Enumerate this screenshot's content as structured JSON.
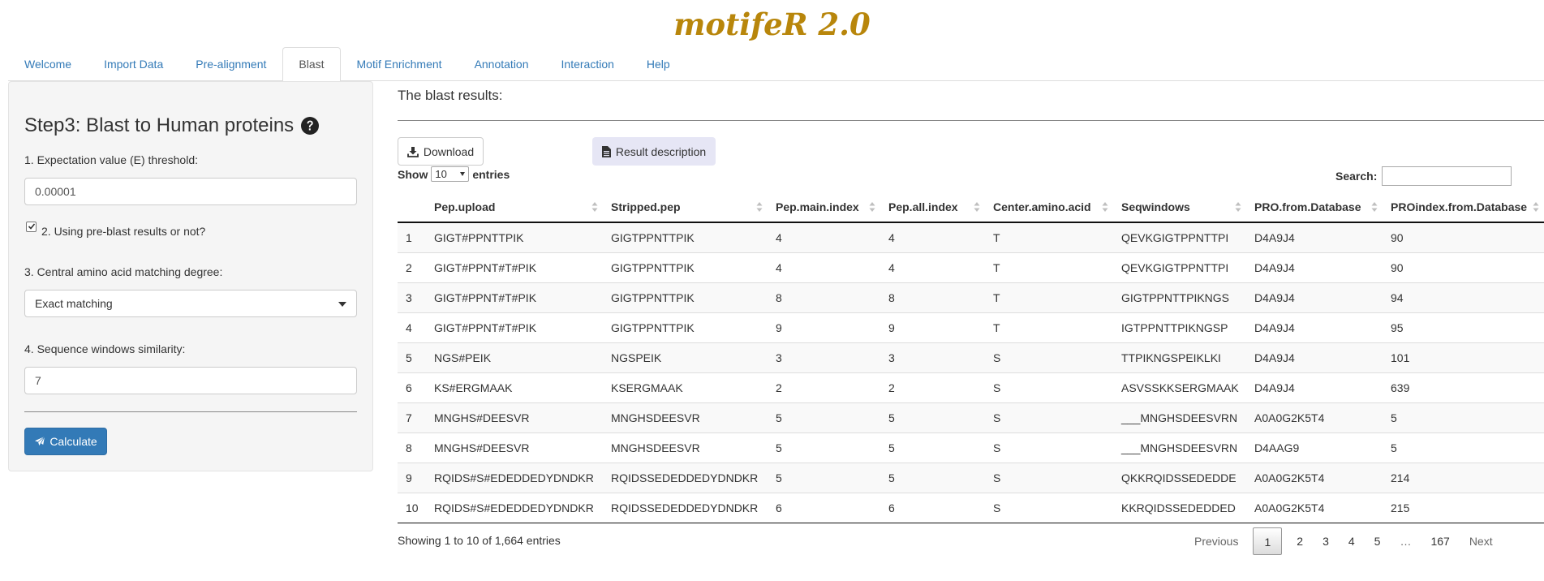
{
  "app": {
    "title": "motifeR 2.0"
  },
  "nav": {
    "tabs": [
      {
        "label": "Welcome"
      },
      {
        "label": "Import Data"
      },
      {
        "label": "Pre-alignment"
      },
      {
        "label": "Blast",
        "active": true
      },
      {
        "label": "Motif Enrichment"
      },
      {
        "label": "Annotation"
      },
      {
        "label": "Interaction"
      },
      {
        "label": "Help"
      }
    ]
  },
  "sidebar": {
    "title": "Step3: Blast to Human proteins",
    "evalue_label": "1. Expectation value (E) threshold:",
    "evalue_value": "0.00001",
    "preblast_label": "2. Using pre-blast results or not?",
    "preblast_checked": true,
    "central_label": "3. Central amino acid matching degree:",
    "central_value": "Exact matching",
    "similarity_label": "4. Sequence windows similarity:",
    "similarity_value": "7",
    "calculate_label": "Calculate"
  },
  "main": {
    "title": "The blast results:",
    "download_label": "Download",
    "description_label": "Result description",
    "show_label": "Show",
    "entries_label": "entries",
    "length_value": "10",
    "search_label": "Search:",
    "search_value": ""
  },
  "table": {
    "columns": [
      "",
      "Pep.upload",
      "Stripped.pep",
      "Pep.main.index",
      "Pep.all.index",
      "Center.amino.acid",
      "Seqwindows",
      "PRO.from.Database",
      "PROindex.from.Database"
    ],
    "rows": [
      [
        "1",
        "GIGT#PPNTTPIK",
        "GIGTPPNTTPIK",
        "4",
        "4",
        "T",
        "QEVKGIGTPPNTTPI",
        "D4A9J4",
        "90"
      ],
      [
        "2",
        "GIGT#PPNT#T#PIK",
        "GIGTPPNTTPIK",
        "4",
        "4",
        "T",
        "QEVKGIGTPPNTTPI",
        "D4A9J4",
        "90"
      ],
      [
        "3",
        "GIGT#PPNT#T#PIK",
        "GIGTPPNTTPIK",
        "8",
        "8",
        "T",
        "GIGTPPNTTPIKNGS",
        "D4A9J4",
        "94"
      ],
      [
        "4",
        "GIGT#PPNT#T#PIK",
        "GIGTPPNTTPIK",
        "9",
        "9",
        "T",
        "IGTPPNTTPIKNGSP",
        "D4A9J4",
        "95"
      ],
      [
        "5",
        "NGS#PEIK",
        "NGSPEIK",
        "3",
        "3",
        "S",
        "TTPIKNGSPEIKLKI",
        "D4A9J4",
        "101"
      ],
      [
        "6",
        "KS#ERGMAAK",
        "KSERGMAAK",
        "2",
        "2",
        "S",
        "ASVSSKKSERGMAAK",
        "D4A9J4",
        "639"
      ],
      [
        "7",
        "MNGHS#DEESVR",
        "MNGHSDEESVR",
        "5",
        "5",
        "S",
        "___MNGHSDEESVRN",
        "A0A0G2K5T4",
        "5"
      ],
      [
        "8",
        "MNGHS#DEESVR",
        "MNGHSDEESVR",
        "5",
        "5",
        "S",
        "___MNGHSDEESVRN",
        "D4AAG9",
        "5"
      ],
      [
        "9",
        "RQIDS#S#EDEDDEDYDNDKR",
        "RQIDSSEDEDDEDYDNDKR",
        "5",
        "5",
        "S",
        "QKKRQIDSSEDEDDE",
        "A0A0G2K5T4",
        "214"
      ],
      [
        "10",
        "RQIDS#S#EDEDDEDYDNDKR",
        "RQIDSSEDEDDEDYDNDKR",
        "6",
        "6",
        "S",
        "KKRQIDSSEDEDDED",
        "A0A0G2K5T4",
        "215"
      ]
    ],
    "info": "Showing 1 to 10 of 1,664 entries"
  },
  "pagination": {
    "previous": "Previous",
    "pages": [
      "1",
      "2",
      "3",
      "4",
      "5",
      "…",
      "167"
    ],
    "current": "1",
    "next": "Next"
  },
  "colors": {
    "title": "#b8860b",
    "link": "#337ab7",
    "primary_button": "#337ab7",
    "description_button": "#e6e6f5",
    "sidebar_bg": "#f5f5f5"
  },
  "icons": {
    "help": "question-circle-icon",
    "download": "download-icon",
    "description": "file-text-icon",
    "calculate": "paper-plane-icon",
    "sort": "sort-icon"
  }
}
